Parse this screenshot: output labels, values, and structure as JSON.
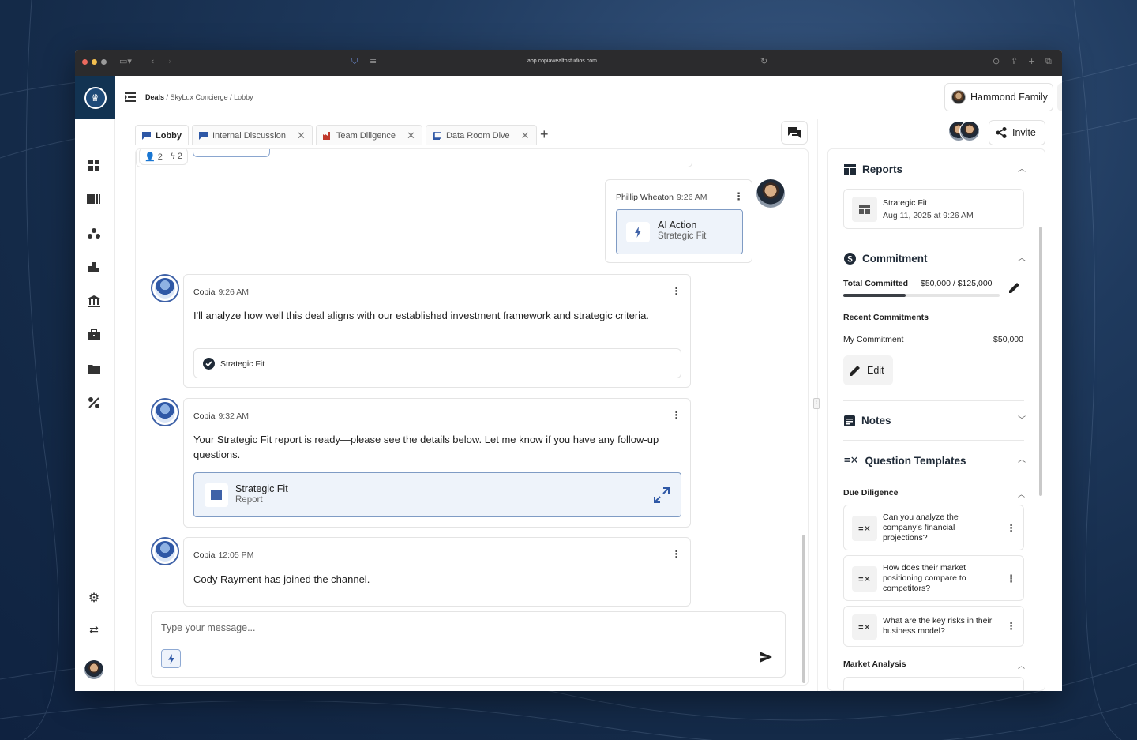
{
  "browser": {
    "url": "app.copiawealthstudios.com"
  },
  "breadcrumb": {
    "root": "Deals",
    "sep1": " / ",
    "mid": "SkyLux Concierge",
    "sep2": " / ",
    "leaf": "Lobby"
  },
  "header": {
    "family_label": "Hammond Family",
    "invite_label": "Invite"
  },
  "tabs": [
    {
      "label": "Lobby",
      "icon": "chat-icon"
    },
    {
      "label": "Internal Discussion",
      "icon": "chat-icon"
    },
    {
      "label": "Team Diligence",
      "icon": "factory-icon"
    },
    {
      "label": "Data Room Dive",
      "icon": "library-icon"
    }
  ],
  "counts": {
    "members": "2",
    "actions": "2"
  },
  "messages": {
    "m1": {
      "author": "Phillip Wheaton",
      "time": "9:26 AM",
      "card_title": "AI Action",
      "card_sub": "Strategic Fit"
    },
    "m2": {
      "author": "Copia",
      "time": "9:26 AM",
      "text": "I'll analyze how well this deal aligns with our established investment framework and strategic criteria.",
      "check_label": "Strategic Fit"
    },
    "m3": {
      "author": "Copia",
      "time": "9:32 AM",
      "text": "Your Strategic Fit report is ready—please see the details below. Let me know if you have any follow-up questions.",
      "card_title": "Strategic Fit",
      "card_sub": "Report"
    },
    "m4": {
      "author": "Copia",
      "time": "12:05 PM",
      "text": "Cody Rayment has joined the channel."
    }
  },
  "composer": {
    "placeholder": "Type your message..."
  },
  "right_panel": {
    "reports": {
      "title": "Reports",
      "item_title": "Strategic Fit",
      "item_date": "Aug 11, 2025 at 9:26 AM"
    },
    "commitment": {
      "title": "Commitment",
      "total_label": "Total Committed",
      "total_value": "$50,000 / $125,000",
      "progress": 0.4,
      "recent_label": "Recent Commitments",
      "my_label": "My Commitment",
      "my_value": "$50,000",
      "edit_label": "Edit"
    },
    "notes": {
      "title": "Notes"
    },
    "question_templates": {
      "title": "Question Templates",
      "due_diligence_label": "Due Diligence",
      "questions": [
        "Can you analyze the company's financial projections?",
        "How does their market positioning compare to competitors?",
        "What are the key risks in their business model?"
      ],
      "market_analysis_label": "Market Analysis"
    }
  },
  "colors": {
    "brand_navy": "#123352",
    "accent_blue": "#3f62a8",
    "progress_fill": "#3b3f45"
  }
}
